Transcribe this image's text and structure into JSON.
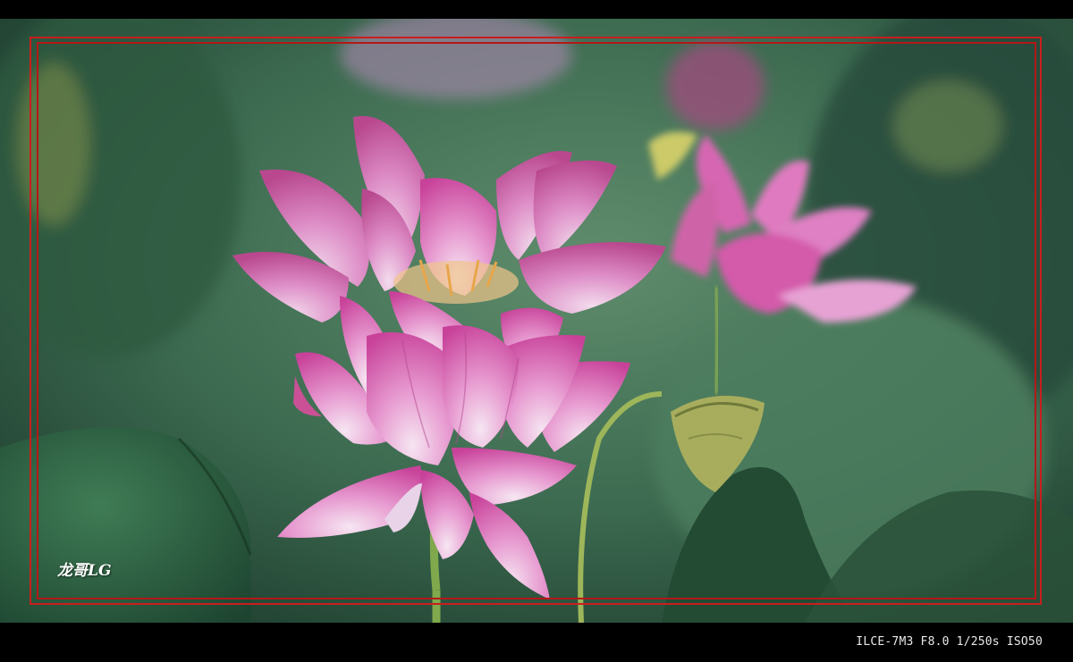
{
  "photo": {
    "subject": "lotus-flowers",
    "colors": {
      "petal_pink": "#d85aa6",
      "petal_light": "#f3d3ec",
      "leaf_green": "#2f6a4a",
      "background_green": "#3d6b52",
      "frame_red": "#c81e1e",
      "letterbox": "#000000"
    }
  },
  "watermark": {
    "text": "龙哥LG"
  },
  "exif": {
    "text": "ILCE-7M3 F8.0 1/250s ISO50"
  }
}
